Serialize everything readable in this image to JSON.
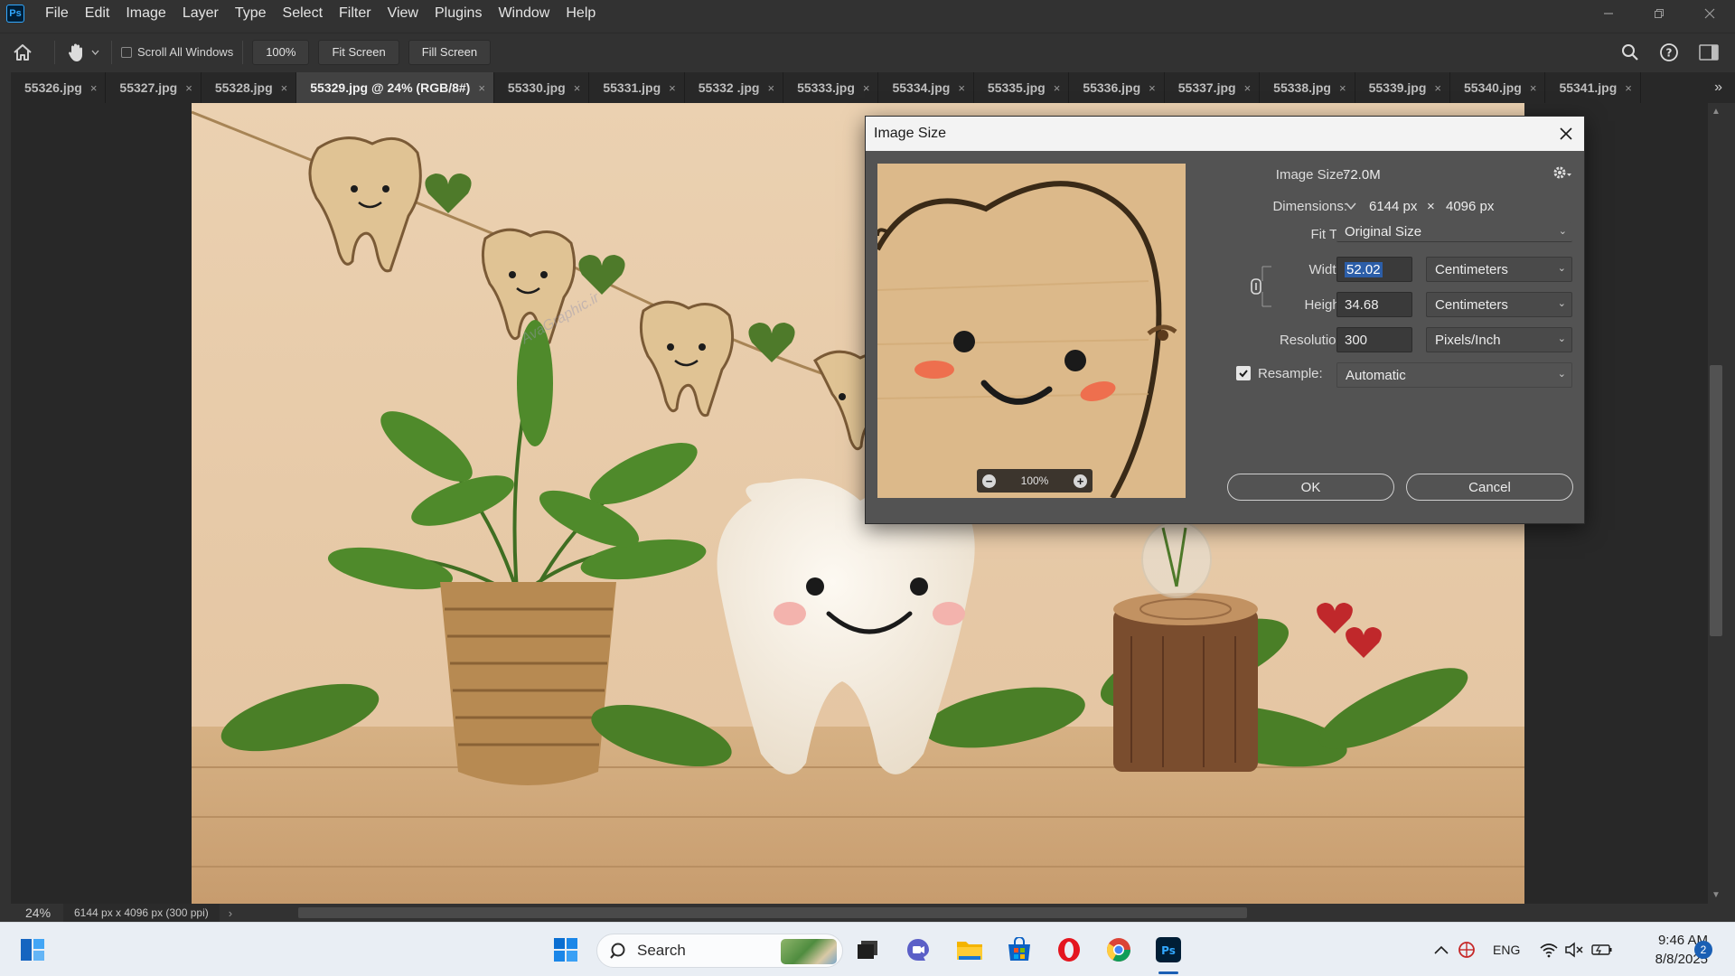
{
  "app": {
    "logo": "Ps"
  },
  "menubar": {
    "items": [
      "File",
      "Edit",
      "Image",
      "Layer",
      "Type",
      "Select",
      "Filter",
      "View",
      "Plugins",
      "Window",
      "Help"
    ]
  },
  "options": {
    "scroll_all_windows": "Scroll All Windows",
    "zoom": "100%",
    "fit_screen": "Fit Screen",
    "fill_screen": "Fill Screen"
  },
  "tabs": [
    {
      "label": "55326.jpg"
    },
    {
      "label": "55327.jpg"
    },
    {
      "label": "55328.jpg"
    },
    {
      "label": "55329.jpg @ 24% (RGB/8#)"
    },
    {
      "label": "55330.jpg"
    },
    {
      "label": "55331.jpg"
    },
    {
      "label": "55332 .jpg"
    },
    {
      "label": "55333.jpg"
    },
    {
      "label": "55334.jpg"
    },
    {
      "label": "55335.jpg"
    },
    {
      "label": "55336.jpg"
    },
    {
      "label": "55337.jpg"
    },
    {
      "label": "55338.jpg"
    },
    {
      "label": "55339.jpg"
    },
    {
      "label": "55340.jpg"
    },
    {
      "label": "55341.jpg"
    }
  ],
  "active_tab_index": 3,
  "tab_close_glyph": "×",
  "tab_overflow_glyph": "»",
  "status": {
    "zoom": "24%",
    "doc_info": "6144 px x 4096 px (300 ppi)",
    "arrow": "›"
  },
  "watermark": {
    "text": "AvaGraphic.ir"
  },
  "dialog": {
    "title": "Image Size",
    "image_size_label": "Image Size:",
    "image_size_value": "72.0M",
    "dimensions_label": "Dimensions:",
    "dimensions_width": "6144 px",
    "dimensions_times": "×",
    "dimensions_height": "4096 px",
    "fit_to_label": "Fit T...",
    "fit_to_value": "Original Size",
    "width_label": "Width:",
    "width_value": "52.02",
    "width_unit": "Centimeters",
    "height_label": "Height:",
    "height_value": "34.68",
    "height_unit": "Centimeters",
    "resolution_label": "Resolution:",
    "resolution_value": "300",
    "resolution_unit": "Pixels/Inch",
    "resample_label": "Resample:",
    "resample_value": "Automatic",
    "resample_checked": true,
    "preview_zoom": "100%",
    "ok": "OK",
    "cancel": "Cancel"
  },
  "taskbar": {
    "search_placeholder": "Search",
    "tray_language": "ENG",
    "time": "9:46 AM",
    "date": "8/8/2025",
    "notifications": "2"
  },
  "colors": {
    "ps_dark": "#323232",
    "canvas_bg": "#282828",
    "dialog_bg": "#535353",
    "accent_blue": "#31a8ff",
    "selection_blue": "#2c5ea8",
    "taskbar_bg": "#e9eef4"
  }
}
